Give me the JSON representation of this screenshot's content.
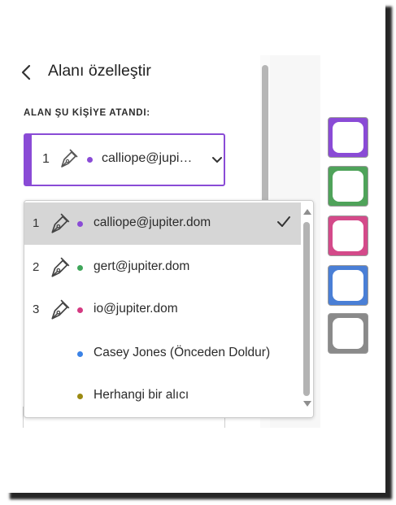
{
  "panel": {
    "title": "Alanı özelleştir",
    "section_label": "ALAN ŞU KİŞİYE ATANDI:",
    "picker": {
      "number": "1",
      "email": "calliope@jupi…",
      "dot_color": "#8a4bd6"
    }
  },
  "dropdown": {
    "options": [
      {
        "number": "1",
        "label": "calliope@jupiter.dom",
        "dot_color": "#8a4bd6",
        "selected": true,
        "icon": "pen-icon"
      },
      {
        "number": "2",
        "label": "gert@jupiter.dom",
        "dot_color": "#3fa65a",
        "selected": false,
        "icon": "pen-icon"
      },
      {
        "number": "3",
        "label": "io@jupiter.dom",
        "dot_color": "#d43a82",
        "selected": false,
        "icon": "pen-icon"
      },
      {
        "number": "",
        "label": "Casey Jones (Önceden Doldur)",
        "dot_color": "#3b82e6",
        "selected": false
      },
      {
        "number": "",
        "label": "Herhangi bir alıcı",
        "dot_color": "#9b8a12",
        "selected": false
      }
    ]
  },
  "swatches": [
    {
      "name": "purple",
      "color": "#8a4bd6"
    },
    {
      "name": "green",
      "color": "#4fa35a"
    },
    {
      "name": "pink",
      "color": "#d44a8a"
    },
    {
      "name": "blue",
      "color": "#4a7fd6"
    },
    {
      "name": "gray",
      "color": "#8a8a8a"
    }
  ]
}
